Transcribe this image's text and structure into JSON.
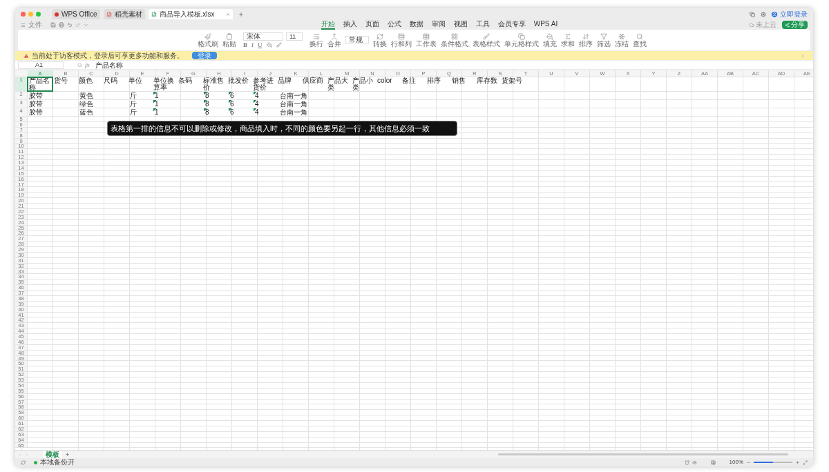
{
  "title_tabs": [
    {
      "label": "WPS Office",
      "selected": false
    },
    {
      "label": "稻壳素材",
      "selected": false
    },
    {
      "label": "商品导入模板.xlsx",
      "selected": true
    }
  ],
  "account": {
    "label": "立即登录"
  },
  "quick_bar": {
    "file_menu": "文件"
  },
  "ribbon_tabs": [
    {
      "label": "开始",
      "selected": true
    },
    {
      "label": "插入",
      "selected": false
    },
    {
      "label": "页面",
      "selected": false
    },
    {
      "label": "公式",
      "selected": false
    },
    {
      "label": "数据",
      "selected": false
    },
    {
      "label": "审阅",
      "selected": false
    },
    {
      "label": "视图",
      "selected": false
    },
    {
      "label": "工具",
      "selected": false
    },
    {
      "label": "会员专享",
      "selected": false
    },
    {
      "label": "WPS AI",
      "selected": false
    }
  ],
  "cloud_status": "未上云",
  "share_button": "分享",
  "ribbon": {
    "font_name": "宋体",
    "font_size": "11",
    "number_format": "常规",
    "format_buttons": [
      "B",
      "I",
      "U"
    ],
    "buttons": [
      "格式刷",
      "粘贴",
      "换行",
      "合并",
      "转换",
      "行和列",
      "工作表",
      "条件格式",
      "表格样式",
      "单元格样式",
      "填充",
      "求和",
      "排序",
      "筛选",
      "冻结",
      "查找"
    ]
  },
  "banner": {
    "message": "当前处于访客模式，登录后可享更多功能和服务。",
    "login_button": "登录"
  },
  "formula_bar": {
    "name_box": "A1",
    "function_label": "fx",
    "formula": "产品名称"
  },
  "hint": "表格第一排的信息不可以删除或修改，商品填入时，不同的颜色要另起一行，其他信息必须一致",
  "columns": [
    {
      "label": "A",
      "selected": true
    },
    {
      "label": "B",
      "selected": false
    },
    {
      "label": "C",
      "selected": false
    },
    {
      "label": "D",
      "selected": false
    },
    {
      "label": "E",
      "selected": false
    },
    {
      "label": "F",
      "selected": false
    },
    {
      "label": "G",
      "selected": false
    },
    {
      "label": "H",
      "selected": false
    },
    {
      "label": "I",
      "selected": false
    },
    {
      "label": "J",
      "selected": false
    },
    {
      "label": "K",
      "selected": false
    },
    {
      "label": "L",
      "selected": false
    },
    {
      "label": "M",
      "selected": false
    },
    {
      "label": "N",
      "selected": false
    },
    {
      "label": "O",
      "selected": false
    },
    {
      "label": "P",
      "selected": false
    },
    {
      "label": "Q",
      "selected": false
    },
    {
      "label": "R",
      "selected": false
    },
    {
      "label": "S",
      "selected": false
    },
    {
      "label": "T",
      "selected": false
    },
    {
      "label": "U",
      "selected": false
    },
    {
      "label": "V",
      "selected": false
    },
    {
      "label": "W",
      "selected": false
    },
    {
      "label": "X",
      "selected": false
    },
    {
      "label": "Y",
      "selected": false
    },
    {
      "label": "Z",
      "selected": false
    },
    {
      "label": "AA",
      "selected": false
    },
    {
      "label": "AB",
      "selected": false
    },
    {
      "label": "AC",
      "selected": false
    },
    {
      "label": "AD",
      "selected": false
    },
    {
      "label": "AE",
      "selected": false
    }
  ],
  "rows": [
    {
      "number": "1",
      "selected": true,
      "cells": [
        {
          "text": "产品名称",
          "flag": false,
          "active": true
        },
        {
          "text": "货号",
          "flag": false,
          "active": false
        },
        {
          "text": "颜色",
          "flag": false,
          "active": false
        },
        {
          "text": "尺码",
          "flag": false,
          "active": false
        },
        {
          "text": "单位",
          "flag": false,
          "active": false
        },
        {
          "text": "单位换算率",
          "flag": false,
          "active": false
        },
        {
          "text": "条码",
          "flag": false,
          "active": false
        },
        {
          "text": "标准售价",
          "flag": false,
          "active": false
        },
        {
          "text": "批发价",
          "flag": false,
          "active": false
        },
        {
          "text": "参考进货价",
          "flag": false,
          "active": false
        },
        {
          "text": "品牌",
          "flag": false,
          "active": false
        },
        {
          "text": "供应商",
          "flag": false,
          "active": false
        },
        {
          "text": "产品大类",
          "flag": false,
          "active": false
        },
        {
          "text": "产品小类",
          "flag": false,
          "active": false
        },
        {
          "text": "color",
          "flag": false,
          "active": false
        },
        {
          "text": "备注",
          "flag": false,
          "active": false
        },
        {
          "text": "排序",
          "flag": false,
          "active": false
        },
        {
          "text": "销售",
          "flag": false,
          "active": false
        },
        {
          "text": "库存数",
          "flag": false,
          "active": false
        },
        {
          "text": "货架号",
          "flag": false,
          "active": false
        }
      ]
    },
    {
      "number": "2",
      "selected": false,
      "cells": [
        {
          "text": "胶带",
          "flag": false,
          "active": false
        },
        null,
        {
          "text": "黄色",
          "flag": false,
          "active": false
        },
        null,
        {
          "text": "斤",
          "flag": false,
          "active": false
        },
        {
          "text": "1",
          "flag": true,
          "active": false
        },
        null,
        {
          "text": "8",
          "flag": true,
          "active": false
        },
        {
          "text": "6",
          "flag": true,
          "active": false
        },
        {
          "text": "4",
          "flag": true,
          "active": false
        },
        {
          "text": "台南一角",
          "flag": false,
          "active": false
        }
      ]
    },
    {
      "number": "3",
      "selected": false,
      "cells": [
        {
          "text": "胶带",
          "flag": false,
          "active": false
        },
        null,
        {
          "text": "绿色",
          "flag": false,
          "active": false
        },
        null,
        {
          "text": "斤",
          "flag": false,
          "active": false
        },
        {
          "text": "1",
          "flag": true,
          "active": false
        },
        null,
        {
          "text": "8",
          "flag": true,
          "active": false
        },
        {
          "text": "6",
          "flag": true,
          "active": false
        },
        {
          "text": "4",
          "flag": true,
          "active": false
        },
        {
          "text": "台南一角",
          "flag": false,
          "active": false
        }
      ]
    },
    {
      "number": "4",
      "selected": false,
      "cells": [
        {
          "text": "胶带",
          "flag": false,
          "active": false
        },
        null,
        {
          "text": "蓝色",
          "flag": false,
          "active": false
        },
        null,
        {
          "text": "斤",
          "flag": false,
          "active": false
        },
        {
          "text": "1",
          "flag": true,
          "active": false
        },
        null,
        {
          "text": "8",
          "flag": true,
          "active": false
        },
        {
          "text": "6",
          "flag": true,
          "active": false
        },
        {
          "text": "4",
          "flag": true,
          "active": false
        },
        {
          "text": "台南一角",
          "flag": false,
          "active": false
        }
      ]
    },
    {
      "number": "5",
      "selected": false
    },
    {
      "number": "6",
      "selected": false
    },
    {
      "number": "7",
      "selected": false
    },
    {
      "number": "8",
      "selected": false
    },
    {
      "number": "9",
      "selected": false
    },
    {
      "number": "10",
      "selected": false
    },
    {
      "number": "11",
      "selected": false
    },
    {
      "number": "12",
      "selected": false
    },
    {
      "number": "13",
      "selected": false
    },
    {
      "number": "14",
      "selected": false
    },
    {
      "number": "15",
      "selected": false
    },
    {
      "number": "16",
      "selected": false
    },
    {
      "number": "17",
      "selected": false
    },
    {
      "number": "18",
      "selected": false
    },
    {
      "number": "19",
      "selected": false
    },
    {
      "number": "20",
      "selected": false
    },
    {
      "number": "21",
      "selected": false
    },
    {
      "number": "22",
      "selected": false
    },
    {
      "number": "23",
      "selected": false
    },
    {
      "number": "24",
      "selected": false
    },
    {
      "number": "25",
      "selected": false
    },
    {
      "number": "26",
      "selected": false
    },
    {
      "number": "27",
      "selected": false
    },
    {
      "number": "28",
      "selected": false
    },
    {
      "number": "29",
      "selected": false
    },
    {
      "number": "30",
      "selected": false
    },
    {
      "number": "31",
      "selected": false
    },
    {
      "number": "32",
      "selected": false
    },
    {
      "number": "33",
      "selected": false
    },
    {
      "number": "34",
      "selected": false
    },
    {
      "number": "35",
      "selected": false
    },
    {
      "number": "36",
      "selected": false
    },
    {
      "number": "37",
      "selected": false
    },
    {
      "number": "38",
      "selected": false
    },
    {
      "number": "39",
      "selected": false
    },
    {
      "number": "40",
      "selected": false
    },
    {
      "number": "41",
      "selected": false
    },
    {
      "number": "42",
      "selected": false
    },
    {
      "number": "43",
      "selected": false
    },
    {
      "number": "44",
      "selected": false
    },
    {
      "number": "45",
      "selected": false
    },
    {
      "number": "46",
      "selected": false
    },
    {
      "number": "47",
      "selected": false
    },
    {
      "number": "48",
      "selected": false
    },
    {
      "number": "49",
      "selected": false
    },
    {
      "number": "50",
      "selected": false
    },
    {
      "number": "51",
      "selected": false
    },
    {
      "number": "52",
      "selected": false
    },
    {
      "number": "53",
      "selected": false
    },
    {
      "number": "54",
      "selected": false
    },
    {
      "number": "55",
      "selected": false
    },
    {
      "number": "56",
      "selected": false
    },
    {
      "number": "57",
      "selected": false
    },
    {
      "number": "58",
      "selected": false
    },
    {
      "number": "59",
      "selected": false
    },
    {
      "number": "60",
      "selected": false
    },
    {
      "number": "61",
      "selected": false
    },
    {
      "number": "62",
      "selected": false
    },
    {
      "number": "63",
      "selected": false
    },
    {
      "number": "64",
      "selected": false
    },
    {
      "number": "65",
      "selected": false
    }
  ],
  "sheet_tabs": [
    {
      "label": "模板",
      "selected": true
    }
  ],
  "status_bar": {
    "backup": "本地备份开",
    "zoom": "100%",
    "zoom_slider": {
      "level": 0.5
    }
  }
}
